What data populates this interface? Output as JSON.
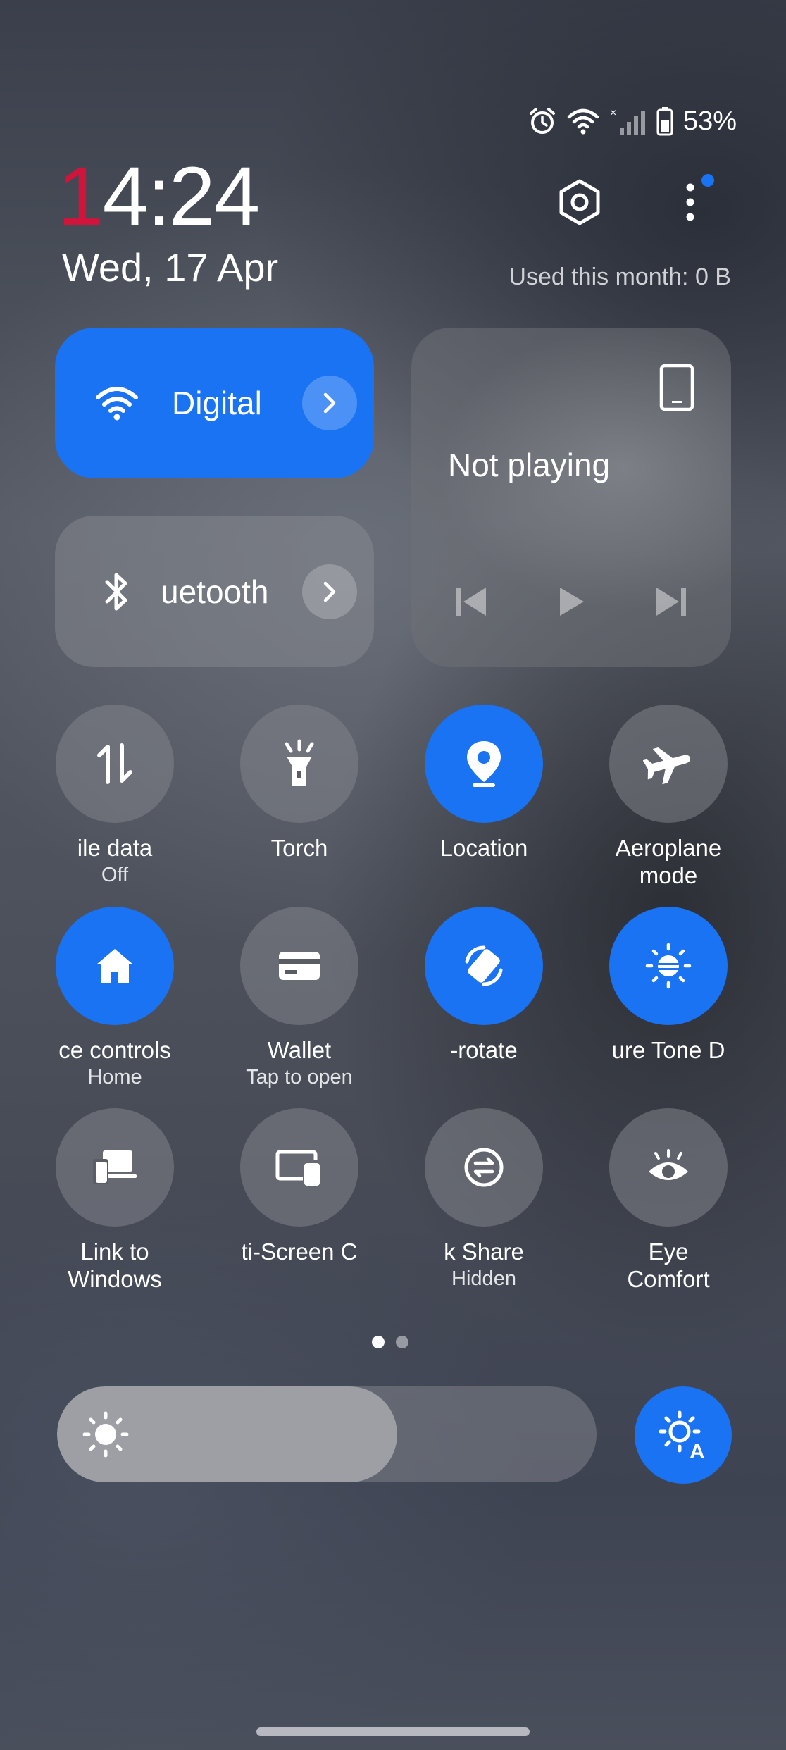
{
  "status_bar": {
    "battery": "53%",
    "icons": [
      "alarm-icon",
      "wifi-icon",
      "no-signal-icon",
      "battery-icon"
    ]
  },
  "header": {
    "clock_first": "1",
    "clock_rest": "4:24",
    "date": "Wed, 17 Apr",
    "usage": "Used this month: 0 B",
    "notification_dot_color": "#1a73f3"
  },
  "tiles": {
    "wifi": {
      "label": "Digital",
      "active": true
    },
    "bluetooth": {
      "label": "uetooth",
      "active": false
    }
  },
  "media": {
    "title": "Not playing"
  },
  "toggles": [
    {
      "label": "ile data",
      "sub": "Off",
      "on": false,
      "icon": "mobile-data-icon"
    },
    {
      "label": "Torch",
      "sub": "",
      "on": false,
      "icon": "torch-icon"
    },
    {
      "label": "Location",
      "sub": "",
      "on": true,
      "icon": "location-icon"
    },
    {
      "label": "Aeroplane\nmode",
      "sub": "",
      "on": false,
      "icon": "aeroplane-icon"
    },
    {
      "label": "ce controls",
      "sub": "Home",
      "on": true,
      "icon": "home-icon"
    },
    {
      "label": "Wallet",
      "sub": "Tap to open",
      "on": false,
      "icon": "wallet-icon"
    },
    {
      "label": "-rotate",
      "sub": "",
      "on": true,
      "icon": "auto-rotate-icon"
    },
    {
      "label": "ure Tone D",
      "sub": "",
      "on": true,
      "icon": "tone-icon"
    },
    {
      "label": "Link to\nWindows",
      "sub": "",
      "on": false,
      "icon": "link-to-windows-icon"
    },
    {
      "label": "ti-Screen C",
      "sub": "",
      "on": false,
      "icon": "multi-screen-icon"
    },
    {
      "label": "k Share",
      "sub": "Hidden",
      "on": false,
      "icon": "quick-share-icon"
    },
    {
      "label": "Eye\nComfort",
      "sub": "",
      "on": false,
      "icon": "eye-comfort-icon"
    }
  ],
  "pages": {
    "current": 1,
    "total": 2
  },
  "brightness": {
    "level": 0.63,
    "auto": true
  },
  "colors": {
    "accent": "#1a73f3",
    "clock_accent": "#d0143c"
  }
}
